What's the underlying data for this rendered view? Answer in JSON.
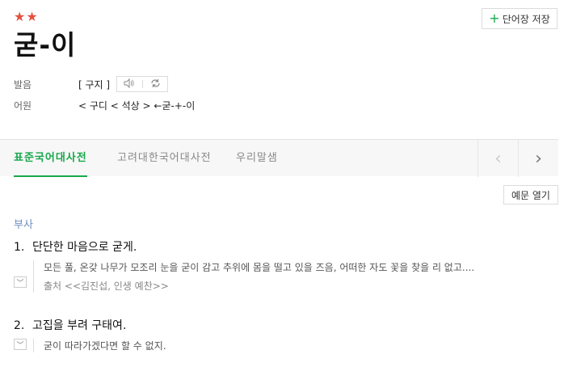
{
  "entry": {
    "stars": "★★",
    "headword": "굳-이",
    "save_button": "단어장 저장"
  },
  "pronunciation": {
    "label": "발음",
    "value": "[ 구지 ]",
    "speaker_icon": "speaker-icon",
    "repeat_icon": "repeat-icon"
  },
  "etymology": {
    "label": "어원",
    "value": "< 구디 < 석상 > ←굳-+-이"
  },
  "tabs": [
    {
      "label": "표준국어대사전",
      "active": true
    },
    {
      "label": "고려대한국어대사전",
      "active": false
    },
    {
      "label": "우리말샘",
      "active": false
    }
  ],
  "nav": {
    "prev": "‹",
    "next": "›"
  },
  "examples_button": "예문 열기",
  "part_of_speech": "부사",
  "senses": [
    {
      "number": "1.",
      "definition": "단단한 마음으로 굳게.",
      "example": "모든 풀, 온갖 나무가 모조리 눈을 굳이 감고 추위에 몸을 떨고 있을 즈음, 어떠한 자도 꽃을 찾을 리 없고....",
      "source": "출처 <<김진섭, 인생 예찬>>"
    },
    {
      "number": "2.",
      "definition": "고집을 부려 구태여.",
      "example": "굳이 따라가겠다면 할 수 없지."
    }
  ],
  "colors": {
    "accent": "#17a84b",
    "stars": "#e5513e",
    "part_of_speech": "#6c8fc0"
  }
}
